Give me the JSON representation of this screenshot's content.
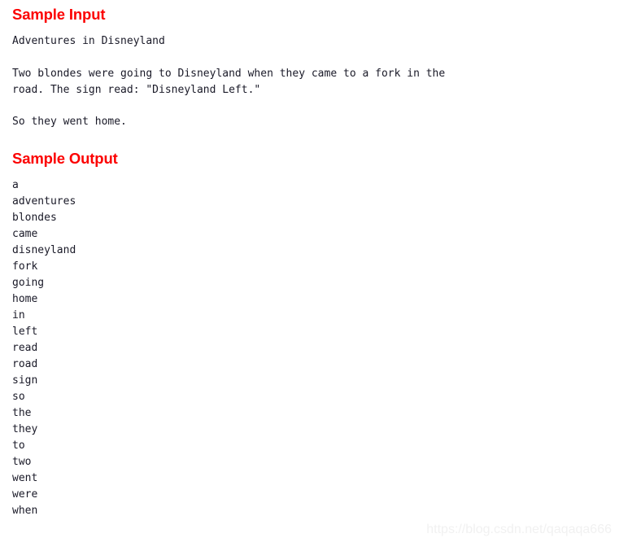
{
  "document": {
    "background_color": "#ffffff",
    "heading_color": "#fc0000",
    "body_text_color": "#1a1a28",
    "watermark_color": "#f1f1f1"
  },
  "sample_input": {
    "heading": "Sample Input",
    "title_line": "Adventures in Disneyland",
    "paragraph": "Two blondes were going to Disneyland when they came to a fork in the\nroad. The sign read: \"Disneyland Left.\"",
    "closing_line": "So they went home."
  },
  "sample_output": {
    "heading": "Sample Output",
    "words": [
      "a",
      "adventures",
      "blondes",
      "came",
      "disneyland",
      "fork",
      "going",
      "home",
      "in",
      "left",
      "read",
      "road",
      "sign",
      "so",
      "the",
      "they",
      "to",
      "two",
      "went",
      "were",
      "when"
    ]
  },
  "watermark": {
    "text": "https://blog.csdn.net/qaqaqa666"
  }
}
